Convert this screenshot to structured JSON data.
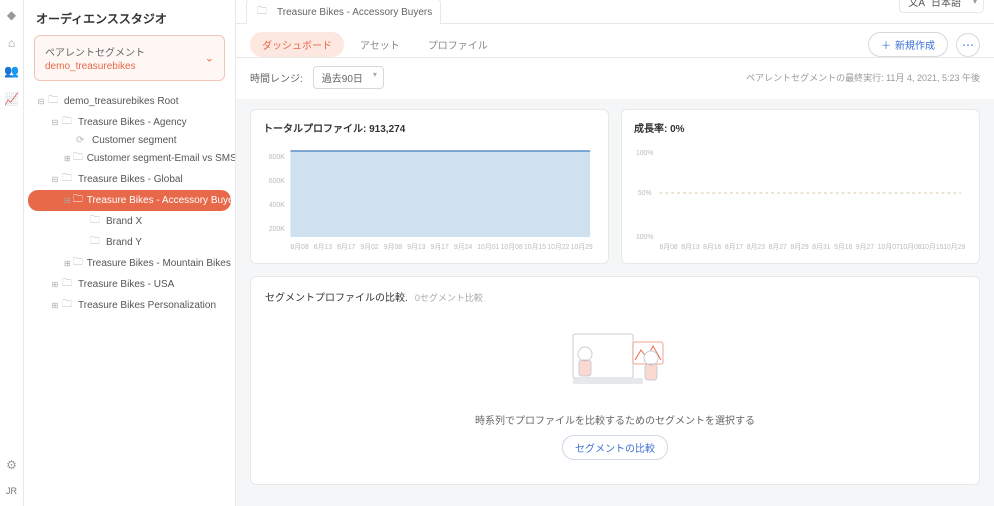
{
  "sidebar": {
    "title": "オーディエンススタジオ",
    "parent_label": "ペアレントセグメント",
    "parent_name": "demo_treasurebikes",
    "tree": [
      {
        "label": "demo_treasurebikes Root",
        "depth": 1,
        "toggle": "⊟"
      },
      {
        "label": "Treasure Bikes - Agency",
        "depth": 2,
        "toggle": "⊟"
      },
      {
        "label": "Customer segment",
        "depth": 3,
        "toggle": "",
        "icon": "refresh"
      },
      {
        "label": "Customer segment-Email vs SMS",
        "depth": 3,
        "toggle": "⊞"
      },
      {
        "label": "Treasure Bikes - Global",
        "depth": 2,
        "toggle": "⊟"
      },
      {
        "label": "Treasure Bikes - Accessory Buyers",
        "depth": 3,
        "toggle": "⊟",
        "active": true
      },
      {
        "label": "Brand X",
        "depth": 4,
        "toggle": ""
      },
      {
        "label": "Brand Y",
        "depth": 4,
        "toggle": ""
      },
      {
        "label": "Treasure Bikes - Mountain Bikes",
        "depth": 3,
        "toggle": "⊞"
      },
      {
        "label": "Treasure Bikes - USA",
        "depth": 2,
        "toggle": "⊞"
      },
      {
        "label": "Treasure Bikes Personalization",
        "depth": 2,
        "toggle": "⊞"
      }
    ]
  },
  "header": {
    "tab_title": "Treasure Bikes - Accessory Buyers",
    "language": "日本語"
  },
  "tabs": {
    "dashboard": "ダッシュボード",
    "assets": "アセット",
    "profile": "プロファイル"
  },
  "actions": {
    "new": "新規作成"
  },
  "timerange": {
    "label": "時間レンジ:",
    "value": "過去90日",
    "last_run": "ペアレントセグメントの最終実行: 11月 4, 2021, 5:23 午後"
  },
  "cards": {
    "total_profiles_label": "トータルプロファイル: ",
    "total_profiles_value": "913,274",
    "growth_label": "成長率: ",
    "growth_value": "0%"
  },
  "compare": {
    "title": "セグメントプロファイルの比較.",
    "sub": "0セグメント比較",
    "empty_text": "時系列でプロファイルを比較するためのセグメントを選択する",
    "button": "セグメントの比較"
  },
  "rail": {
    "initials": "JR"
  },
  "chart_data": [
    {
      "type": "area",
      "title": "トータルプロファイル",
      "ylim": [
        0,
        1000000
      ],
      "yticks": [
        "200K",
        "400K",
        "600K",
        "800K"
      ],
      "categories": [
        "8月08",
        "8月13",
        "8月17",
        "9月02",
        "9月08",
        "9月13",
        "9月17",
        "9月24",
        "10月01",
        "10月08",
        "10月15",
        "10月22",
        "10月29"
      ],
      "values": [
        913274,
        913274,
        913274,
        913274,
        913274,
        913274,
        913274,
        913274,
        913274,
        913274,
        913274,
        913274,
        913274
      ]
    },
    {
      "type": "line",
      "title": "成長率",
      "ylim": [
        0,
        100
      ],
      "yticks": [
        "100%",
        "50%",
        "100%"
      ],
      "categories": [
        "8月08",
        "8月13",
        "8月16",
        "8月17",
        "8月23",
        "8月27",
        "8月29",
        "8月31",
        "9月16",
        "9月27",
        "10月07",
        "10月08",
        "10月15",
        "10月29"
      ],
      "values": [
        0,
        0,
        0,
        0,
        0,
        0,
        0,
        0,
        0,
        0,
        0,
        0,
        0,
        0
      ]
    }
  ]
}
